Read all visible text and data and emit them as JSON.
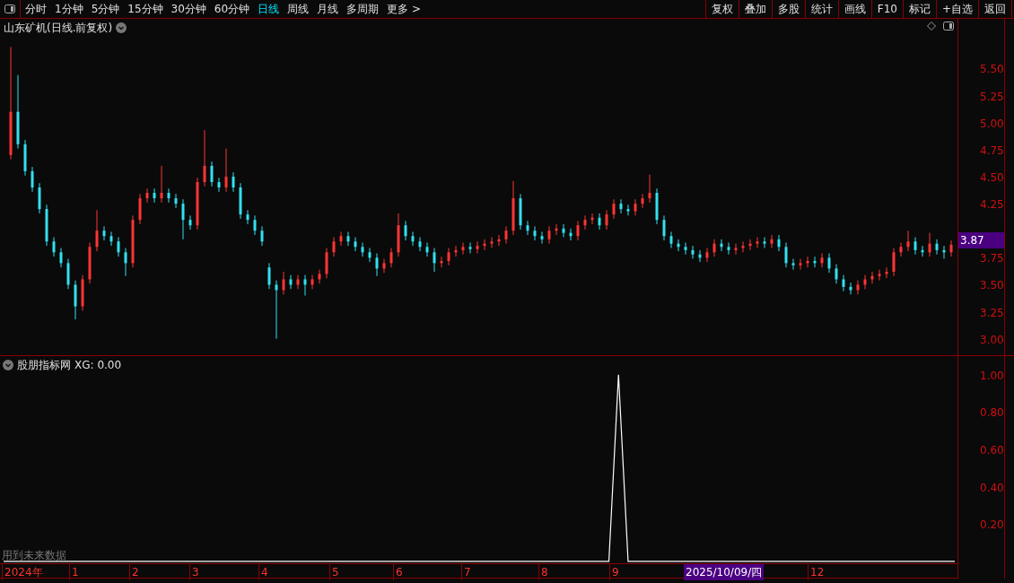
{
  "toolbar": {
    "periods": [
      {
        "label": "分时",
        "selected": false
      },
      {
        "label": "1分钟",
        "selected": false
      },
      {
        "label": "5分钟",
        "selected": false
      },
      {
        "label": "15分钟",
        "selected": false
      },
      {
        "label": "30分钟",
        "selected": false
      },
      {
        "label": "60分钟",
        "selected": false
      },
      {
        "label": "日线",
        "selected": true
      },
      {
        "label": "周线",
        "selected": false
      },
      {
        "label": "月线",
        "selected": false
      },
      {
        "label": "多周期",
        "selected": false
      },
      {
        "label": "更多 >",
        "selected": false
      }
    ],
    "buttons": [
      "复权",
      "叠加",
      "多股",
      "统计",
      "画线",
      "F10",
      "标记",
      "+自选",
      "返回"
    ]
  },
  "price_chart": {
    "title": "山东矿机(日线.前复权)",
    "last_price": "3.87",
    "chart_data": {
      "type": "candlestick",
      "ylim": [
        2.84,
        5.96
      ],
      "yticks": [
        {
          "value": 5.5,
          "label": "5.50"
        },
        {
          "value": 5.25,
          "label": "5.25"
        },
        {
          "value": 5.0,
          "label": "5.00"
        },
        {
          "value": 4.75,
          "label": "4.75"
        },
        {
          "value": 4.5,
          "label": "4.50"
        },
        {
          "value": 4.25,
          "label": "4.25"
        },
        {
          "value": 3.75,
          "label": "3.75"
        },
        {
          "value": 3.5,
          "label": "3.50"
        },
        {
          "value": 3.25,
          "label": "3.25"
        },
        {
          "value": 3.0,
          "label": "3.00"
        }
      ],
      "ohlc": [
        [
          4.7,
          5.7,
          4.66,
          5.1
        ],
        [
          5.1,
          5.44,
          4.76,
          4.8
        ],
        [
          4.8,
          4.84,
          4.51,
          4.55
        ],
        [
          4.55,
          4.59,
          4.36,
          4.4
        ],
        [
          4.4,
          4.44,
          4.16,
          4.2
        ],
        [
          4.2,
          4.24,
          3.86,
          3.9
        ],
        [
          3.9,
          3.94,
          3.76,
          3.8
        ],
        [
          3.8,
          3.84,
          3.66,
          3.7
        ],
        [
          3.7,
          3.74,
          3.46,
          3.5
        ],
        [
          3.5,
          3.54,
          3.18,
          3.3
        ],
        [
          3.3,
          3.59,
          3.26,
          3.55
        ],
        [
          3.55,
          3.89,
          3.51,
          3.85
        ],
        [
          3.85,
          4.19,
          3.81,
          4.0
        ],
        [
          4.0,
          4.04,
          3.91,
          3.95
        ],
        [
          3.95,
          3.99,
          3.86,
          3.9
        ],
        [
          3.9,
          3.94,
          3.76,
          3.8
        ],
        [
          3.8,
          3.84,
          3.58,
          3.7
        ],
        [
          3.7,
          4.14,
          3.66,
          4.1
        ],
        [
          4.1,
          4.34,
          4.06,
          4.3
        ],
        [
          4.3,
          4.39,
          4.26,
          4.35
        ],
        [
          4.35,
          4.39,
          4.26,
          4.3
        ],
        [
          4.3,
          4.6,
          4.26,
          4.35
        ],
        [
          4.35,
          4.39,
          4.26,
          4.3
        ],
        [
          4.3,
          4.34,
          4.21,
          4.25
        ],
        [
          4.25,
          4.29,
          3.92,
          4.1
        ],
        [
          4.1,
          4.14,
          4.01,
          4.05
        ],
        [
          4.05,
          4.49,
          4.01,
          4.45
        ],
        [
          4.45,
          4.93,
          4.41,
          4.6
        ],
        [
          4.6,
          4.64,
          4.41,
          4.45
        ],
        [
          4.45,
          4.49,
          4.36,
          4.4
        ],
        [
          4.4,
          4.76,
          4.36,
          4.5
        ],
        [
          4.5,
          4.54,
          4.36,
          4.4
        ],
        [
          4.4,
          4.44,
          4.11,
          4.15
        ],
        [
          4.15,
          4.19,
          4.06,
          4.1
        ],
        [
          4.1,
          4.14,
          3.96,
          4.0
        ],
        [
          4.0,
          4.04,
          3.86,
          3.9
        ],
        [
          3.66,
          3.7,
          3.46,
          3.5
        ],
        [
          3.5,
          3.54,
          3.0,
          3.45
        ],
        [
          3.45,
          3.62,
          3.41,
          3.55
        ],
        [
          3.55,
          3.59,
          3.46,
          3.5
        ],
        [
          3.5,
          3.59,
          3.46,
          3.55
        ],
        [
          3.55,
          3.59,
          3.4,
          3.5
        ],
        [
          3.5,
          3.59,
          3.46,
          3.55
        ],
        [
          3.55,
          3.64,
          3.51,
          3.6
        ],
        [
          3.6,
          3.84,
          3.56,
          3.8
        ],
        [
          3.8,
          3.94,
          3.76,
          3.9
        ],
        [
          3.9,
          3.99,
          3.86,
          3.95
        ],
        [
          3.95,
          3.99,
          3.86,
          3.9
        ],
        [
          3.9,
          3.94,
          3.81,
          3.85
        ],
        [
          3.85,
          3.89,
          3.76,
          3.8
        ],
        [
          3.8,
          3.84,
          3.71,
          3.75
        ],
        [
          3.75,
          3.79,
          3.58,
          3.65
        ],
        [
          3.65,
          3.74,
          3.61,
          3.7
        ],
        [
          3.7,
          3.84,
          3.66,
          3.8
        ],
        [
          3.8,
          4.16,
          3.76,
          4.05
        ],
        [
          4.05,
          4.09,
          3.91,
          3.95
        ],
        [
          3.95,
          3.99,
          3.86,
          3.9
        ],
        [
          3.9,
          3.94,
          3.81,
          3.85
        ],
        [
          3.85,
          3.89,
          3.76,
          3.8
        ],
        [
          3.8,
          3.84,
          3.62,
          3.7
        ],
        [
          3.7,
          3.76,
          3.66,
          3.72
        ],
        [
          3.72,
          3.84,
          3.68,
          3.8
        ],
        [
          3.8,
          3.86,
          3.76,
          3.82
        ],
        [
          3.82,
          3.89,
          3.78,
          3.85
        ],
        [
          3.85,
          3.89,
          3.79,
          3.83
        ],
        [
          3.83,
          3.9,
          3.79,
          3.86
        ],
        [
          3.86,
          3.92,
          3.82,
          3.88
        ],
        [
          3.88,
          3.94,
          3.84,
          3.9
        ],
        [
          3.9,
          3.96,
          3.86,
          3.92
        ],
        [
          3.92,
          4.04,
          3.88,
          4.0
        ],
        [
          4.0,
          4.46,
          3.96,
          4.3
        ],
        [
          4.3,
          4.34,
          4.01,
          4.05
        ],
        [
          4.05,
          4.09,
          3.96,
          4.0
        ],
        [
          4.0,
          4.04,
          3.91,
          3.95
        ],
        [
          3.95,
          3.99,
          3.88,
          3.92
        ],
        [
          3.92,
          4.04,
          3.88,
          4.0
        ],
        [
          4.0,
          4.06,
          3.96,
          4.02
        ],
        [
          4.02,
          4.06,
          3.94,
          3.98
        ],
        [
          3.98,
          4.02,
          3.91,
          3.95
        ],
        [
          3.95,
          4.09,
          3.91,
          4.05
        ],
        [
          4.05,
          4.14,
          4.01,
          4.1
        ],
        [
          4.1,
          4.16,
          4.06,
          4.12
        ],
        [
          4.12,
          4.16,
          4.01,
          4.05
        ],
        [
          4.05,
          4.19,
          4.01,
          4.15
        ],
        [
          4.15,
          4.29,
          4.11,
          4.25
        ],
        [
          4.25,
          4.29,
          4.16,
          4.2
        ],
        [
          4.2,
          4.24,
          4.14,
          4.18
        ],
        [
          4.18,
          4.29,
          4.14,
          4.25
        ],
        [
          4.25,
          4.34,
          4.21,
          4.3
        ],
        [
          4.3,
          4.52,
          4.26,
          4.35
        ],
        [
          4.35,
          4.39,
          4.06,
          4.1
        ],
        [
          4.1,
          4.14,
          3.91,
          3.95
        ],
        [
          3.95,
          3.99,
          3.84,
          3.88
        ],
        [
          3.88,
          3.92,
          3.81,
          3.85
        ],
        [
          3.85,
          3.89,
          3.78,
          3.82
        ],
        [
          3.82,
          3.86,
          3.74,
          3.78
        ],
        [
          3.78,
          3.82,
          3.71,
          3.75
        ],
        [
          3.75,
          3.84,
          3.71,
          3.8
        ],
        [
          3.8,
          3.92,
          3.76,
          3.88
        ],
        [
          3.88,
          3.92,
          3.81,
          3.85
        ],
        [
          3.85,
          3.89,
          3.78,
          3.82
        ],
        [
          3.82,
          3.88,
          3.78,
          3.84
        ],
        [
          3.84,
          3.9,
          3.8,
          3.86
        ],
        [
          3.86,
          3.92,
          3.82,
          3.88
        ],
        [
          3.88,
          3.94,
          3.84,
          3.9
        ],
        [
          3.9,
          3.94,
          3.84,
          3.88
        ],
        [
          3.88,
          3.96,
          3.84,
          3.92
        ],
        [
          3.92,
          3.96,
          3.81,
          3.85
        ],
        [
          3.85,
          3.89,
          3.66,
          3.7
        ],
        [
          3.7,
          3.74,
          3.64,
          3.68
        ],
        [
          3.68,
          3.74,
          3.64,
          3.7
        ],
        [
          3.7,
          3.76,
          3.66,
          3.72
        ],
        [
          3.72,
          3.76,
          3.66,
          3.7
        ],
        [
          3.7,
          3.79,
          3.66,
          3.75
        ],
        [
          3.75,
          3.79,
          3.61,
          3.65
        ],
        [
          3.65,
          3.69,
          3.51,
          3.55
        ],
        [
          3.55,
          3.59,
          3.44,
          3.48
        ],
        [
          3.48,
          3.52,
          3.41,
          3.45
        ],
        [
          3.45,
          3.54,
          3.41,
          3.5
        ],
        [
          3.5,
          3.59,
          3.46,
          3.55
        ],
        [
          3.55,
          3.62,
          3.51,
          3.58
        ],
        [
          3.58,
          3.64,
          3.54,
          3.6
        ],
        [
          3.6,
          3.66,
          3.56,
          3.62
        ],
        [
          3.62,
          3.84,
          3.58,
          3.8
        ],
        [
          3.8,
          3.89,
          3.76,
          3.85
        ],
        [
          3.85,
          4.0,
          3.81,
          3.9
        ],
        [
          3.9,
          3.94,
          3.78,
          3.82
        ],
        [
          3.82,
          3.86,
          3.76,
          3.8
        ],
        [
          3.8,
          3.98,
          3.76,
          3.88
        ],
        [
          3.88,
          3.92,
          3.78,
          3.82
        ],
        [
          3.82,
          3.86,
          3.74,
          3.8
        ],
        [
          3.8,
          3.91,
          3.76,
          3.87
        ]
      ]
    }
  },
  "indicator": {
    "title": "股朋指标网",
    "reading": ": 0.00",
    "note": "用到未来数据",
    "chart_data": {
      "type": "line",
      "ylim": [
        -0.01,
        1.1
      ],
      "categories": [
        null,
        null,
        null,
        null,
        null,
        null,
        null,
        null,
        null,
        null,
        null,
        null,
        null,
        null,
        null,
        null,
        null,
        null,
        null,
        null,
        null,
        null,
        null,
        null,
        null,
        null,
        null,
        null,
        null,
        null,
        null,
        null,
        null,
        null,
        null,
        null,
        null,
        null,
        null,
        null,
        null,
        null,
        null,
        null,
        null,
        null,
        null,
        null,
        null,
        null,
        null,
        null,
        null,
        null,
        null,
        null,
        null,
        null,
        null,
        null,
        null,
        null,
        null,
        null,
        null,
        null,
        null,
        null,
        null,
        null,
        null,
        null,
        null,
        null,
        null,
        null,
        null,
        null,
        null,
        null,
        null,
        null,
        null,
        null,
        null,
        null,
        null,
        null,
        null,
        null,
        null,
        null,
        null,
        null,
        null,
        null,
        null,
        null,
        null,
        null
      ],
      "yticks": [
        {
          "value": 1.0,
          "label": "1.00"
        },
        {
          "value": 0.8,
          "label": "0.80"
        },
        {
          "value": 0.6,
          "label": "0.60"
        },
        {
          "value": 0.4,
          "label": "0.40"
        },
        {
          "value": 0.2,
          "label": "0.20"
        }
      ],
      "series": [
        {
          "name": "XG",
          "color": "#ffffff",
          "values": [
            0,
            0,
            0,
            0,
            0,
            0,
            0,
            0,
            0,
            0,
            0,
            0,
            0,
            0,
            0,
            0,
            0,
            0,
            0,
            0,
            0,
            0,
            0,
            0,
            0,
            0,
            0,
            0,
            0,
            0,
            0,
            0,
            0,
            0,
            0,
            0,
            0,
            0,
            0,
            0,
            0,
            0,
            0,
            0,
            0,
            0,
            0,
            0,
            0,
            0,
            0,
            0,
            0,
            0,
            0,
            0,
            0,
            0,
            0,
            0,
            0,
            0,
            0,
            0,
            1,
            0,
            0,
            0,
            0,
            0,
            0,
            0,
            0,
            0,
            0,
            0,
            0,
            0,
            0,
            0,
            0,
            0,
            0,
            0,
            0,
            0,
            0,
            0,
            0,
            0,
            0,
            0,
            0,
            0,
            0,
            0,
            0,
            0,
            0,
            0
          ]
        }
      ]
    }
  },
  "x_axis": [
    {
      "label": "2024年",
      "selected": false
    },
    {
      "label": "1",
      "selected": false
    },
    {
      "label": "2",
      "selected": false
    },
    {
      "label": "3",
      "selected": false
    },
    {
      "label": "4",
      "selected": false
    },
    {
      "label": "5",
      "selected": false
    },
    {
      "label": "6",
      "selected": false
    },
    {
      "label": "7",
      "selected": false
    },
    {
      "label": "8",
      "selected": false
    },
    {
      "label": "9",
      "selected": false
    },
    {
      "label": "2025/10/09/四",
      "selected": true
    },
    {
      "label": "12",
      "selected": false
    }
  ]
}
